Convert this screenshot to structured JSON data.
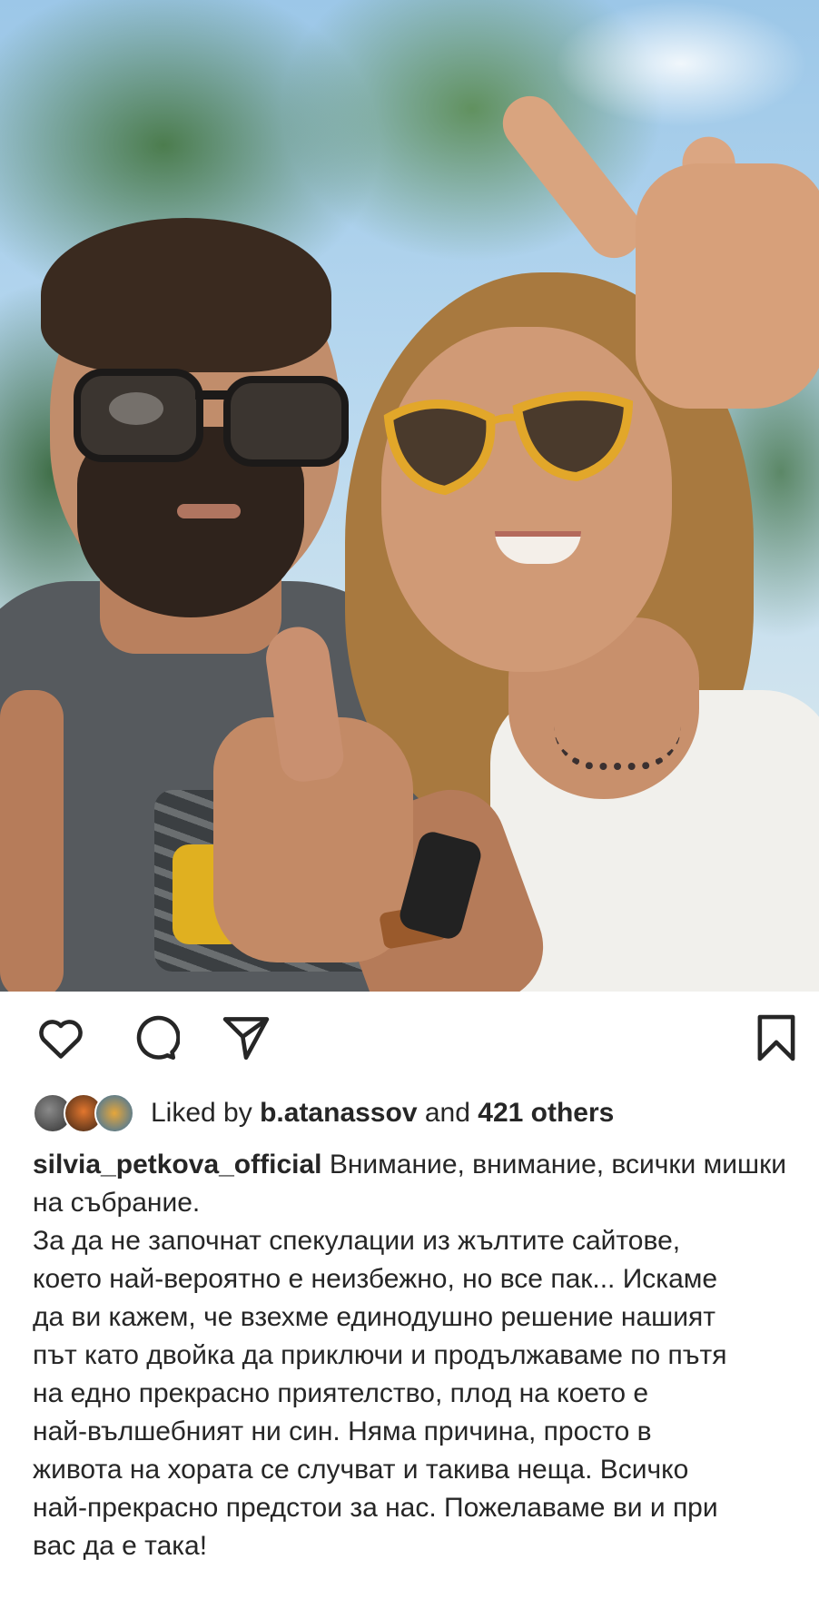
{
  "post": {
    "image_alt": "Selfie of a man and a woman in sunglasses outdoors under trees",
    "username": "silvia_petkova_official",
    "caption_first": "Внимание, внимание, всички мишки на събрание.",
    "caption_lines": [
      "За да не започнат спекулации из жълтите сайтове,",
      "което най-вероятно е неизбежно, но все пак... Искаме",
      "да ви кажем, че взехме единодушно решение нашият",
      "път като двойка да приключи и продължаваме по пътя",
      "на едно прекрасно приятелство, плод на което е",
      "най-вълшебният ни син. Няма причина, просто в",
      "живота на хората се случват и такива неща. Всичко",
      "най-прекрасно предстои за нас. Пожелаваме ви и при",
      "вас да е така!"
    ]
  },
  "actions": {
    "like_icon": "heart-icon",
    "comment_icon": "comment-icon",
    "share_icon": "send-icon",
    "save_icon": "bookmark-icon"
  },
  "likes": {
    "prefix": "Liked by",
    "liker": "b.atanassov",
    "middle": "and",
    "others": "421 others"
  }
}
